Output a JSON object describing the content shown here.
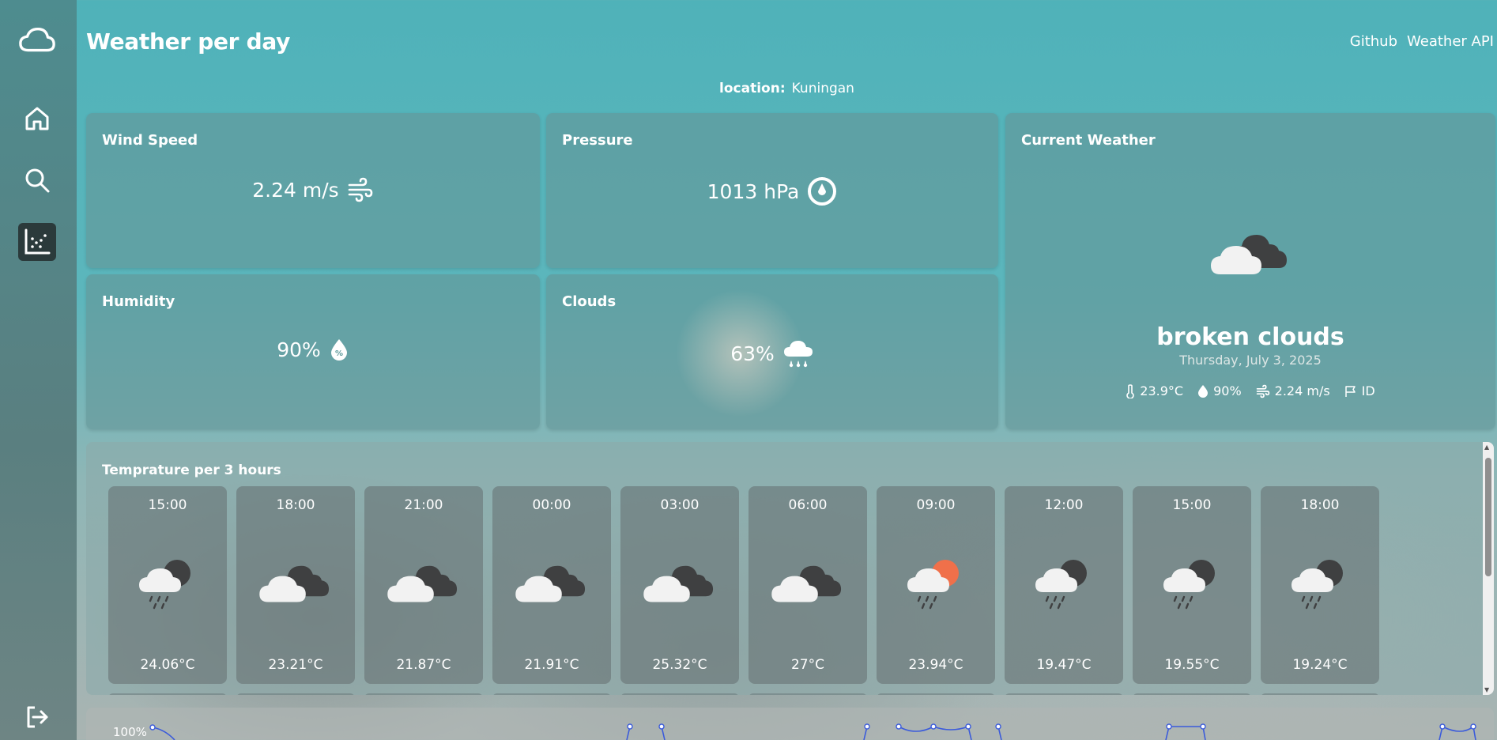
{
  "app": {
    "title": "Weather per day",
    "links": [
      "Github",
      "Weather API"
    ]
  },
  "sidebar": {
    "items": [
      {
        "icon": "cloud-icon"
      },
      {
        "icon": "home-icon"
      },
      {
        "icon": "search-icon"
      },
      {
        "icon": "scatter-chart-icon",
        "active": true
      },
      {
        "icon": "logout-icon"
      }
    ]
  },
  "location": {
    "label": "location:",
    "value": "Kuningan"
  },
  "cards": {
    "wind": {
      "title": "Wind Speed",
      "value": "2.24 m/s"
    },
    "pressure": {
      "title": "Pressure",
      "value": "1013 hPa"
    },
    "humidity": {
      "title": "Humidity",
      "value": "90%"
    },
    "clouds": {
      "title": "Clouds",
      "value": "63%"
    }
  },
  "current": {
    "title": "Current Weather",
    "condition": "broken clouds",
    "date": "Thursday, July 3, 2025",
    "temp": "23.9°C",
    "humidity": "90%",
    "wind": "2.24 m/s",
    "country": "ID"
  },
  "hourly": {
    "title": "Temprature per 3 hours",
    "items": [
      {
        "time": "15:00",
        "temp": "24.06°C",
        "icon": "rain-night-icon"
      },
      {
        "time": "18:00",
        "temp": "23.21°C",
        "icon": "broken-clouds-icon"
      },
      {
        "time": "21:00",
        "temp": "21.87°C",
        "icon": "broken-clouds-icon"
      },
      {
        "time": "00:00",
        "temp": "21.91°C",
        "icon": "broken-clouds-icon"
      },
      {
        "time": "03:00",
        "temp": "25.32°C",
        "icon": "broken-clouds-icon"
      },
      {
        "time": "06:00",
        "temp": "27°C",
        "icon": "broken-clouds-icon"
      },
      {
        "time": "09:00",
        "temp": "23.94°C",
        "icon": "rain-day-icon"
      },
      {
        "time": "12:00",
        "temp": "19.47°C",
        "icon": "rain-night-icon"
      },
      {
        "time": "15:00",
        "temp": "19.55°C",
        "icon": "rain-night-icon"
      },
      {
        "time": "18:00",
        "temp": "19.24°C",
        "icon": "rain-night-icon"
      }
    ]
  },
  "chart": {
    "ylabel_top": "100%"
  },
  "colors": {
    "accent_blue": "#3b5bdb",
    "sun": "#f0704a"
  }
}
